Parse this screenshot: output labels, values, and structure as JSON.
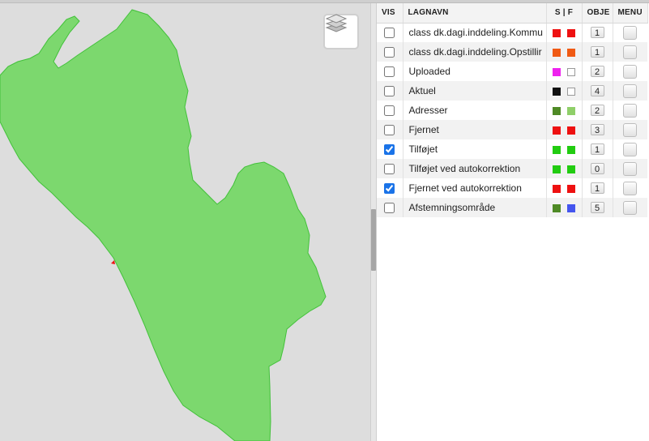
{
  "map": {
    "layer_switcher_icon": "layers-icon",
    "colors": {
      "background": "#dddddd",
      "polygon_fill": "#7cd86e",
      "polygon_stroke": "#42c13a"
    }
  },
  "layer_table": {
    "headers": {
      "vis": "VIS",
      "name": "LAGNAVN",
      "sf": "S | F",
      "objects": "OBJE",
      "menu": "MENU"
    },
    "rows": [
      {
        "name": "class dk.dagi.inddeling.Kommu",
        "checked": false,
        "stroke": "#ee1111",
        "fill": "#ee1111",
        "count": "1"
      },
      {
        "name": "class dk.dagi.inddeling.Opstillir",
        "checked": false,
        "stroke": "#f05a14",
        "fill": "#f05a14",
        "count": "1"
      },
      {
        "name": "Uploaded",
        "checked": false,
        "stroke": "#ee22ee",
        "fill": "#ffffff",
        "count": "2"
      },
      {
        "name": "Aktuel",
        "checked": false,
        "stroke": "#111111",
        "fill": "#ffffff",
        "count": "4"
      },
      {
        "name": "Adresser",
        "checked": false,
        "stroke": "#4f8a26",
        "fill": "#8fcf69",
        "count": "2"
      },
      {
        "name": "Fjernet",
        "checked": false,
        "stroke": "#ee1111",
        "fill": "#ee1111",
        "count": "3"
      },
      {
        "name": "Tilføjet",
        "checked": true,
        "stroke": "#22cc11",
        "fill": "#22cc11",
        "count": "1"
      },
      {
        "name": "Tilføjet ved autokorrektion",
        "checked": false,
        "stroke": "#22cc11",
        "fill": "#22cc11",
        "count": "0"
      },
      {
        "name": "Fjernet ved autokorrektion",
        "checked": true,
        "stroke": "#ee1111",
        "fill": "#ee1111",
        "count": "1"
      },
      {
        "name": "Afstemningsområde",
        "checked": false,
        "stroke": "#4f8a26",
        "fill": "#4455ee",
        "count": "5"
      }
    ]
  }
}
